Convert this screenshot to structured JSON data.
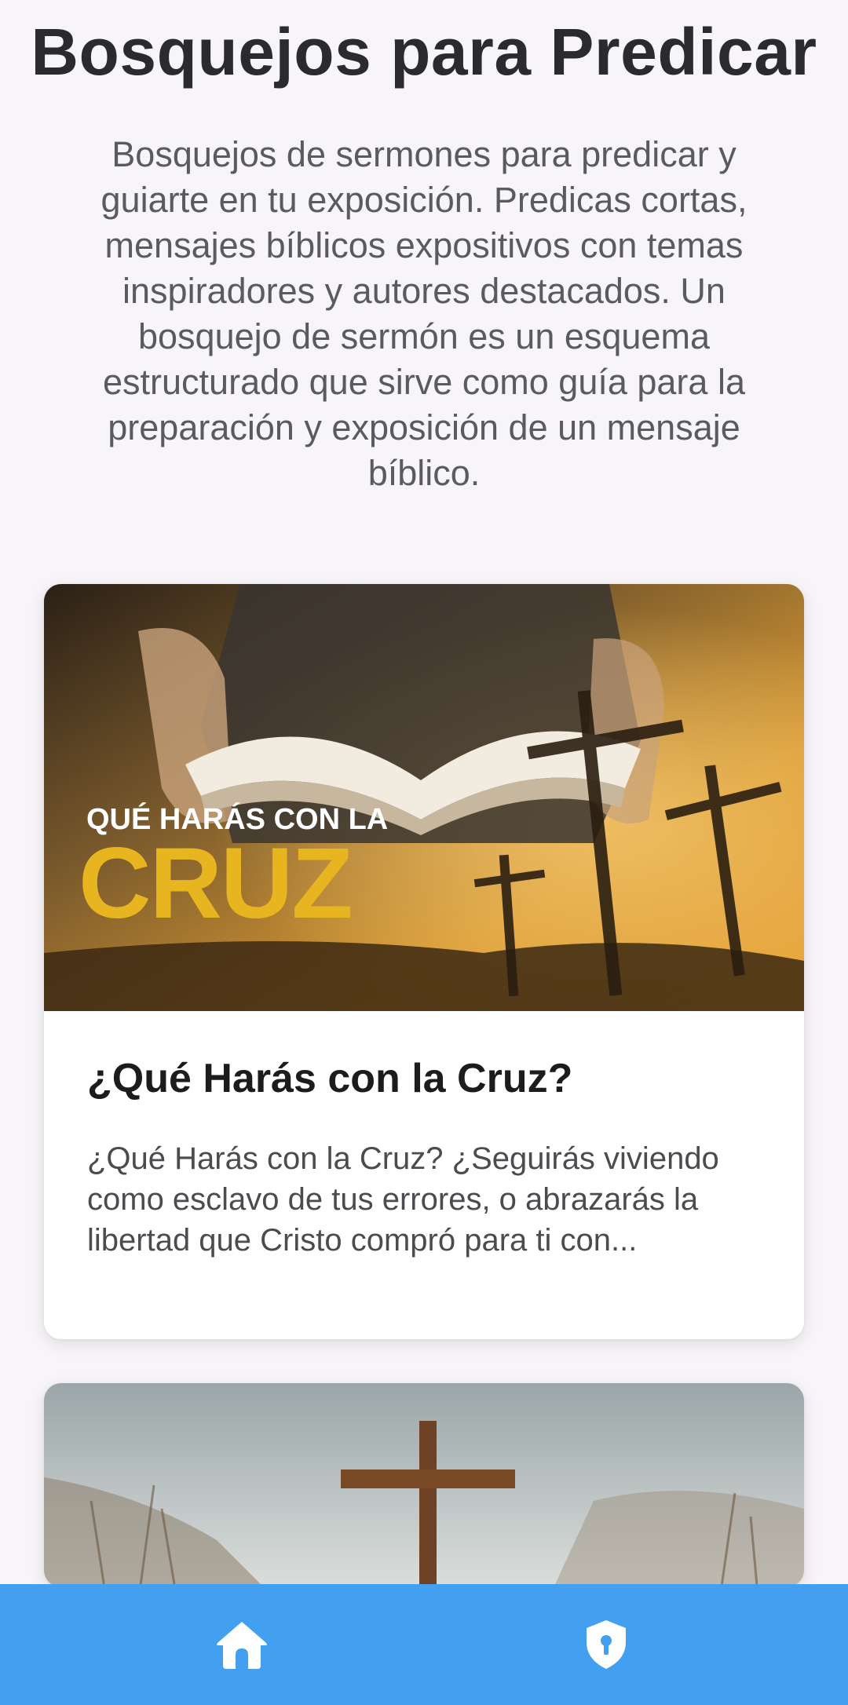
{
  "header": {
    "title": "Bosquejos para Predicar",
    "description": "Bosquejos de sermones para predicar y guiarte en tu exposición. Predicas cortas, mensajes bíblicos expositivos con temas inspiradores y autores destacados. Un bosquejo de sermón es un esquema estructurado que sirve como guía para la preparación y exposición de un mensaje bíblico."
  },
  "posts": [
    {
      "image_line1": "QUÉ HARÁS CON LA",
      "image_line2": "CRUZ",
      "title": "¿Qué Harás con la Cruz?",
      "excerpt": "¿Qué Harás con la Cruz? ¿Seguirás viviendo como esclavo de tus errores, o abrazarás la libertad que Cristo compró para ti con..."
    }
  ],
  "nav": {
    "items": [
      {
        "icon": "home-icon"
      },
      {
        "icon": "shield-lock-icon"
      }
    ]
  },
  "colors": {
    "background": "#f7f5f8",
    "nav_bar": "#43a0f1",
    "title_text": "#2b2b2e",
    "body_text": "#5a5a5f",
    "image_accent_yellow": "#e7b51f"
  }
}
